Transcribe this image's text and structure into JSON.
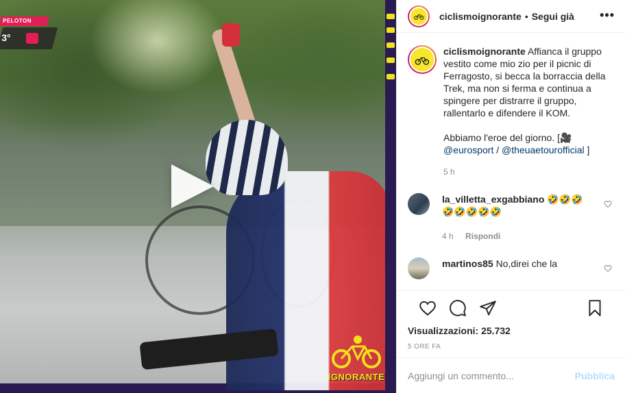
{
  "post": {
    "username": "ciclismoignorante",
    "separator": "•",
    "follow_status": "Segui già",
    "more_label": "•••",
    "caption_p1": "Affianca il gruppo vestito come mio zio per il picnic di Ferragosto, si becca la borraccia della Trek, ma non si ferma e continua a spingere per distrarre il gruppo, rallentarlo e difendere il KOM.",
    "caption_p2_text": "Abbiamo l'eroe del giorno. [🎥",
    "mention_1": "@eurosport",
    "mention_sep": " / ",
    "mention_2": "@theuaetourofficial",
    "caption_close": " ]",
    "caption_time": "5 h"
  },
  "comments": [
    {
      "username": "la_villetta_exgabbiano",
      "text": "🤣🤣🤣🤣🤣🤣🤣🤣",
      "time": "4 h",
      "reply_label": "Rispondi"
    },
    {
      "username": "martinos85",
      "text": "No,direi che la"
    }
  ],
  "stats": {
    "views_label": "Visualizzazioni:",
    "views_value": "25.732",
    "time_ago": "5 ORE FA"
  },
  "add_comment": {
    "placeholder": "Aggiungi un commento...",
    "publish_label": "Pubblica"
  },
  "video": {
    "watermark_text": "IGNORANTE",
    "stage_label": "PELOTON",
    "temperature": "3°"
  },
  "colors": {
    "brand_yellow": "#f2e21b",
    "brand_purple": "#2a1a52",
    "link": "#00376b",
    "publish_disabled": "#b2dffc",
    "muted": "#8e8e8e"
  }
}
